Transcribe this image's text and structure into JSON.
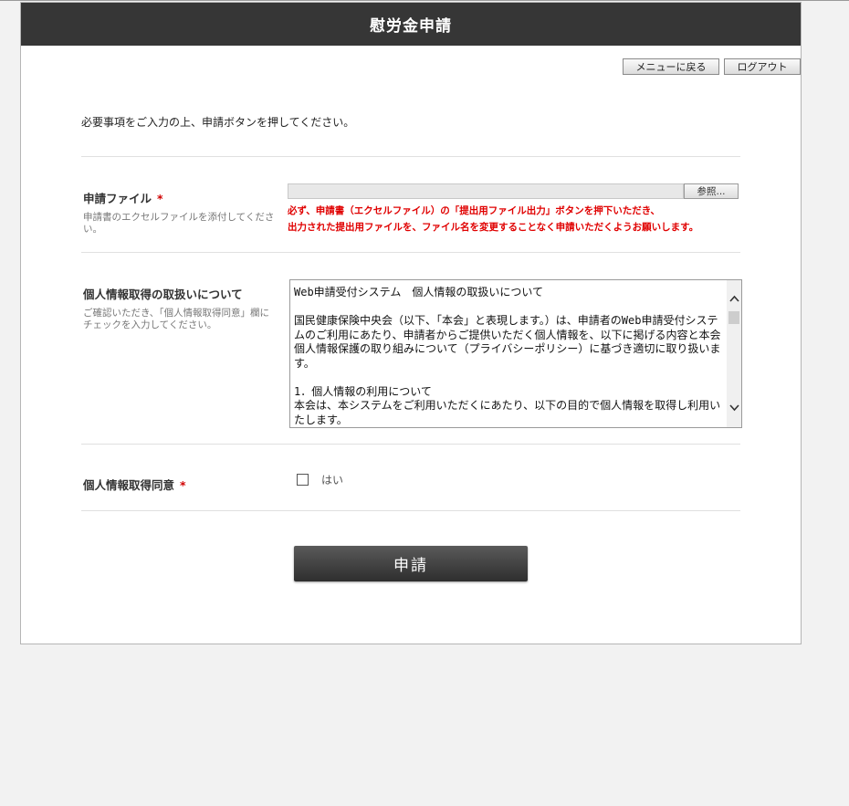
{
  "header": {
    "title": "慰労金申請"
  },
  "nav": {
    "menu_button": "メニューに戻る",
    "logout_button": "ログアウト"
  },
  "intro": "必要事項をご入力の上、申請ボタンを押してください。",
  "file_field": {
    "label": "申請ファイル",
    "required_mark": "*",
    "help": "申請書のエクセルファイルを添付してください。",
    "browse_button": "参照...",
    "warning_line1": "必ず、申請書（エクセルファイル）の「提出用ファイル出力」ボタンを押下いただき、",
    "warning_line2": "出力された提出用ファイルを、ファイル名を変更することなく申請いただくようお願いします。"
  },
  "privacy_field": {
    "label": "個人情報取得の取扱いについて",
    "help": "ご確認いただき、「個人情報取得同意」欄にチェックを入力してください。",
    "text": "Web申請受付システム　個人情報の取扱いについて\n\n国民健康保険中央会（以下、「本会」と表現します。）は、申請者のWeb申請受付システムのご利用にあたり、申請者からご提供いただく個人情報を、以下に掲げる内容と本会個人情報保護の取り組みについて（プライバシーポリシー）に基づき適切に取り扱います。\n\n1．個人情報の利用について\n本会は、本システムをご利用いただくにあたり、以下の目的で個人情報を取得し利用いたします。\n・本システムを適切に提供するため"
  },
  "consent_field": {
    "label": "個人情報取得同意",
    "required_mark": "*",
    "checkbox_label": "はい",
    "checked": false
  },
  "submit_button": "申請",
  "icons": {
    "scroll_up": "chevron-up-icon",
    "scroll_down": "chevron-down-icon"
  }
}
